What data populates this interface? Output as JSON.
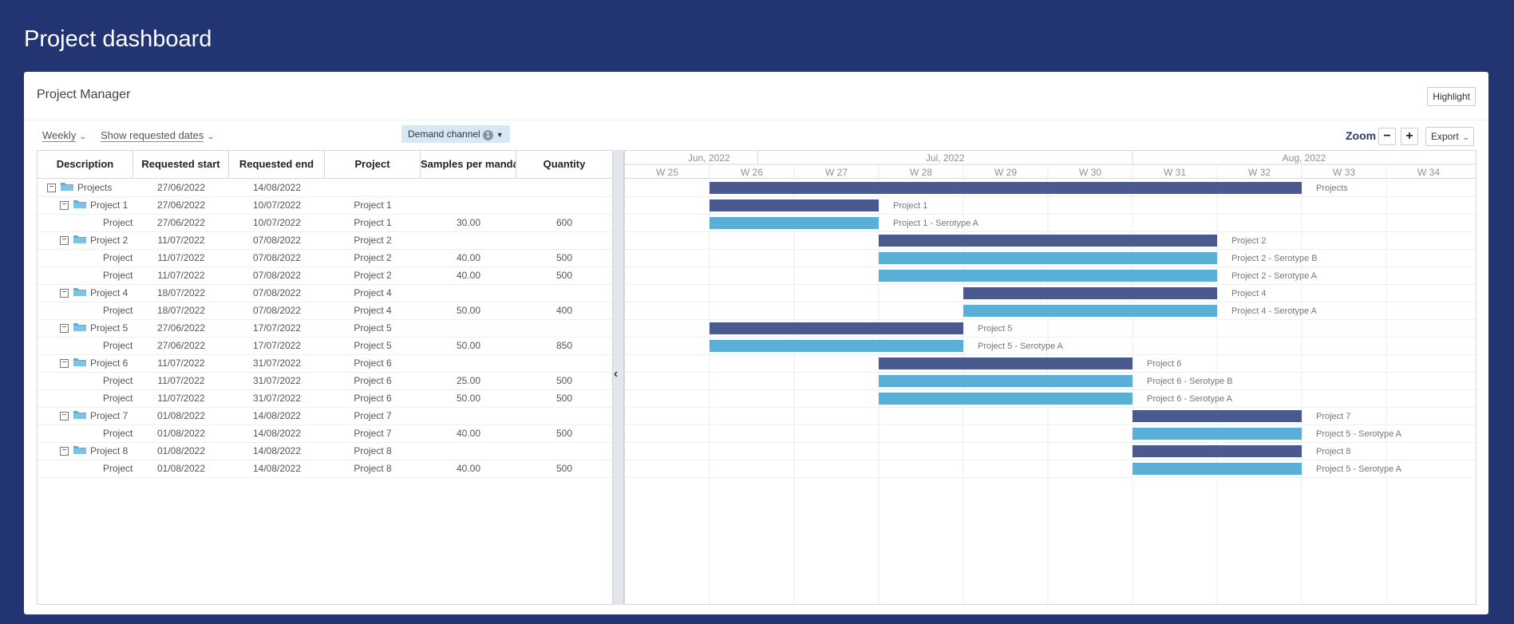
{
  "page_title": "Project dashboard",
  "card": {
    "title": "Project Manager",
    "highlight_label": "Highlight"
  },
  "toolbar": {
    "period_label": "Weekly",
    "dates_label": "Show requested dates",
    "demand_label": "Demand channel",
    "demand_count": "1",
    "zoom_label": "Zoom",
    "zoom_out": "−",
    "zoom_in": "+",
    "export_label": "Export"
  },
  "grid": {
    "columns": [
      "Description",
      "Requested start",
      "Requested end",
      "Project",
      "Samples per mandate",
      "Quantity"
    ],
    "rows": [
      {
        "level": 0,
        "type": "folder",
        "desc": "Projects",
        "start": "27/06/2022",
        "end": "14/08/2022",
        "project": "",
        "samples": "",
        "qty": ""
      },
      {
        "level": 1,
        "type": "folder",
        "desc": "Project 1",
        "start": "27/06/2022",
        "end": "10/07/2022",
        "project": "Project 1",
        "samples": "",
        "qty": ""
      },
      {
        "level": 2,
        "type": "leaf",
        "desc": "Project",
        "start": "27/06/2022",
        "end": "10/07/2022",
        "project": "Project 1",
        "samples": "30.00",
        "qty": "600"
      },
      {
        "level": 1,
        "type": "folder",
        "desc": "Project 2",
        "start": "11/07/2022",
        "end": "07/08/2022",
        "project": "Project 2",
        "samples": "",
        "qty": ""
      },
      {
        "level": 2,
        "type": "leaf",
        "desc": "Project",
        "start": "11/07/2022",
        "end": "07/08/2022",
        "project": "Project 2",
        "samples": "40.00",
        "qty": "500"
      },
      {
        "level": 2,
        "type": "leaf",
        "desc": "Project",
        "start": "11/07/2022",
        "end": "07/08/2022",
        "project": "Project 2",
        "samples": "40.00",
        "qty": "500"
      },
      {
        "level": 1,
        "type": "folder",
        "desc": "Project 4",
        "start": "18/07/2022",
        "end": "07/08/2022",
        "project": "Project 4",
        "samples": "",
        "qty": ""
      },
      {
        "level": 2,
        "type": "leaf",
        "desc": "Project",
        "start": "18/07/2022",
        "end": "07/08/2022",
        "project": "Project 4",
        "samples": "50.00",
        "qty": "400"
      },
      {
        "level": 1,
        "type": "folder",
        "desc": "Project 5",
        "start": "27/06/2022",
        "end": "17/07/2022",
        "project": "Project 5",
        "samples": "",
        "qty": ""
      },
      {
        "level": 2,
        "type": "leaf",
        "desc": "Project",
        "start": "27/06/2022",
        "end": "17/07/2022",
        "project": "Project 5",
        "samples": "50.00",
        "qty": "850"
      },
      {
        "level": 1,
        "type": "folder",
        "desc": "Project 6",
        "start": "11/07/2022",
        "end": "31/07/2022",
        "project": "Project 6",
        "samples": "",
        "qty": ""
      },
      {
        "level": 2,
        "type": "leaf",
        "desc": "Project",
        "start": "11/07/2022",
        "end": "31/07/2022",
        "project": "Project 6",
        "samples": "25.00",
        "qty": "500"
      },
      {
        "level": 2,
        "type": "leaf",
        "desc": "Project",
        "start": "11/07/2022",
        "end": "31/07/2022",
        "project": "Project 6",
        "samples": "50.00",
        "qty": "500"
      },
      {
        "level": 1,
        "type": "folder",
        "desc": "Project 7",
        "start": "01/08/2022",
        "end": "14/08/2022",
        "project": "Project 7",
        "samples": "",
        "qty": ""
      },
      {
        "level": 2,
        "type": "leaf",
        "desc": "Project",
        "start": "01/08/2022",
        "end": "14/08/2022",
        "project": "Project 7",
        "samples": "40.00",
        "qty": "500"
      },
      {
        "level": 1,
        "type": "folder",
        "desc": "Project 8",
        "start": "01/08/2022",
        "end": "14/08/2022",
        "project": "Project 8",
        "samples": "",
        "qty": ""
      },
      {
        "level": 2,
        "type": "leaf",
        "desc": "Project",
        "start": "01/08/2022",
        "end": "14/08/2022",
        "project": "Project 8",
        "samples": "40.00",
        "qty": "500"
      }
    ]
  },
  "gantt": {
    "months": [
      "Jun, 2022",
      "Jul, 2022",
      "Aug, 2022"
    ],
    "weeks": [
      "W 25",
      "W 26",
      "W 27",
      "W 28",
      "W 29",
      "W 30",
      "W 31",
      "W 32",
      "W 33",
      "W 34"
    ],
    "bar_labels": [
      "Projects",
      "Project 1",
      "Project 1 - Serotype A",
      "Project 2",
      "Project 2 - Serotype B",
      "Project 2 - Serotype A",
      "Project 4",
      "Project 4 - Serotype A",
      "Project 5",
      "Project 5 - Serotype A",
      "Project 6",
      "Project 6 - Serotype B",
      "Project 6 - Serotype A",
      "Project 7",
      "Project 5 - Serotype A",
      "Project 8",
      "Project 5 - Serotype A"
    ],
    "colors": {
      "summary": "#4a5a8e",
      "task": "#5aafd6",
      "grid": "#eceef2",
      "header_text": "#8a8f99"
    }
  }
}
